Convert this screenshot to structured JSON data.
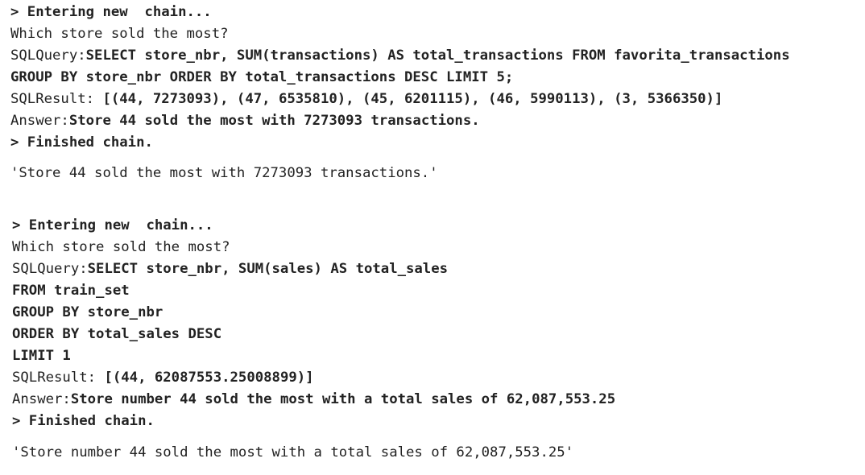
{
  "runs": [
    {
      "entering": "> Entering new  chain...",
      "question": "Which store sold the most?",
      "query_label": "SQLQuery:",
      "query_lines": [
        "SELECT store_nbr, SUM(transactions) AS total_transactions FROM favorita_transactions",
        "GROUP BY store_nbr ORDER BY total_transactions DESC LIMIT 5;"
      ],
      "result_label": "SQLResult: ",
      "result_value": "[(44, 7273093), (47, 6535810), (45, 6201115), (46, 5990113), (3, 5366350)]",
      "answer_label": "Answer:",
      "answer_text": "Store 44 sold the most with 7273093 transactions.",
      "finished": "> Finished chain.",
      "output": "'Store 44 sold the most with 7273093 transactions.'"
    },
    {
      "entering": "> Entering new  chain...",
      "question": "Which store sold the most?",
      "query_label": "SQLQuery:",
      "query_lines": [
        "SELECT store_nbr, SUM(sales) AS total_sales",
        "FROM train_set",
        "GROUP BY store_nbr",
        "ORDER BY total_sales DESC",
        "LIMIT 1"
      ],
      "result_label": "SQLResult: ",
      "result_value": "[(44, 62087553.25008899)]",
      "answer_label": "Answer:",
      "answer_text": "Store number 44 sold the most with a total sales of 62,087,553.25",
      "finished": "> Finished chain.",
      "output": "'Store number 44 sold the most with a total sales of 62,087,553.25'"
    }
  ]
}
